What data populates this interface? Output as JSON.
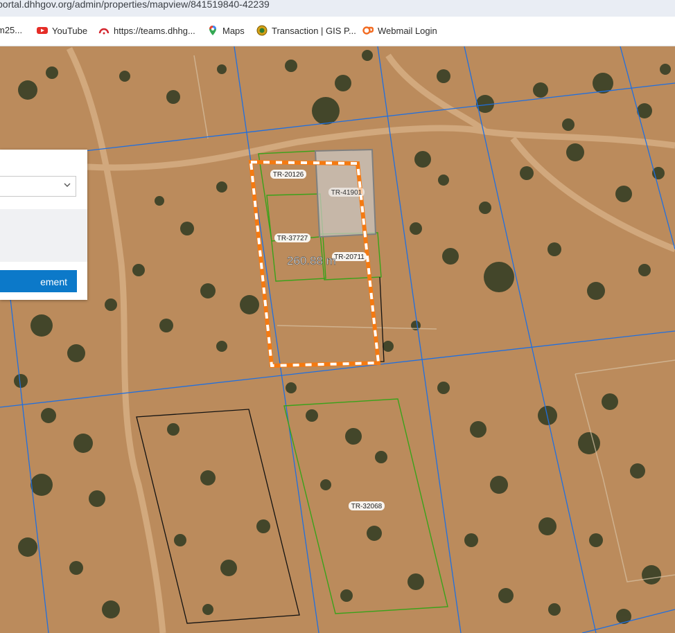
{
  "browser": {
    "url": "portal.dhhgov.org/admin/properties/mapview/841519840-42239",
    "bookmarks": [
      {
        "label": "m25...",
        "icon": "favicon-icon"
      },
      {
        "label": "YouTube",
        "icon": "youtube-icon"
      },
      {
        "label": "https://teams.dhhg...",
        "icon": "teams-icon"
      },
      {
        "label": "Maps",
        "icon": "maps-pin-icon"
      },
      {
        "label": "Transaction | GIS P...",
        "icon": "gis-portal-icon"
      },
      {
        "label": "Webmail Login",
        "icon": "cpanel-icon"
      }
    ]
  },
  "panel": {
    "select_value": "",
    "action_button": "ement"
  },
  "map": {
    "measurement": "260.88 m",
    "parcels": [
      {
        "id": "TR-20126"
      },
      {
        "id": "TR-41901"
      },
      {
        "id": "TR-37727"
      },
      {
        "id": "TR-20711"
      },
      {
        "id": "TR-32068"
      }
    ],
    "colors": {
      "grid": "#1f6fe0",
      "parcel_green": "#39a21a",
      "parcel_black": "#111111",
      "selection_orange": "#f47a12",
      "terrain": "#b98a5c"
    }
  }
}
